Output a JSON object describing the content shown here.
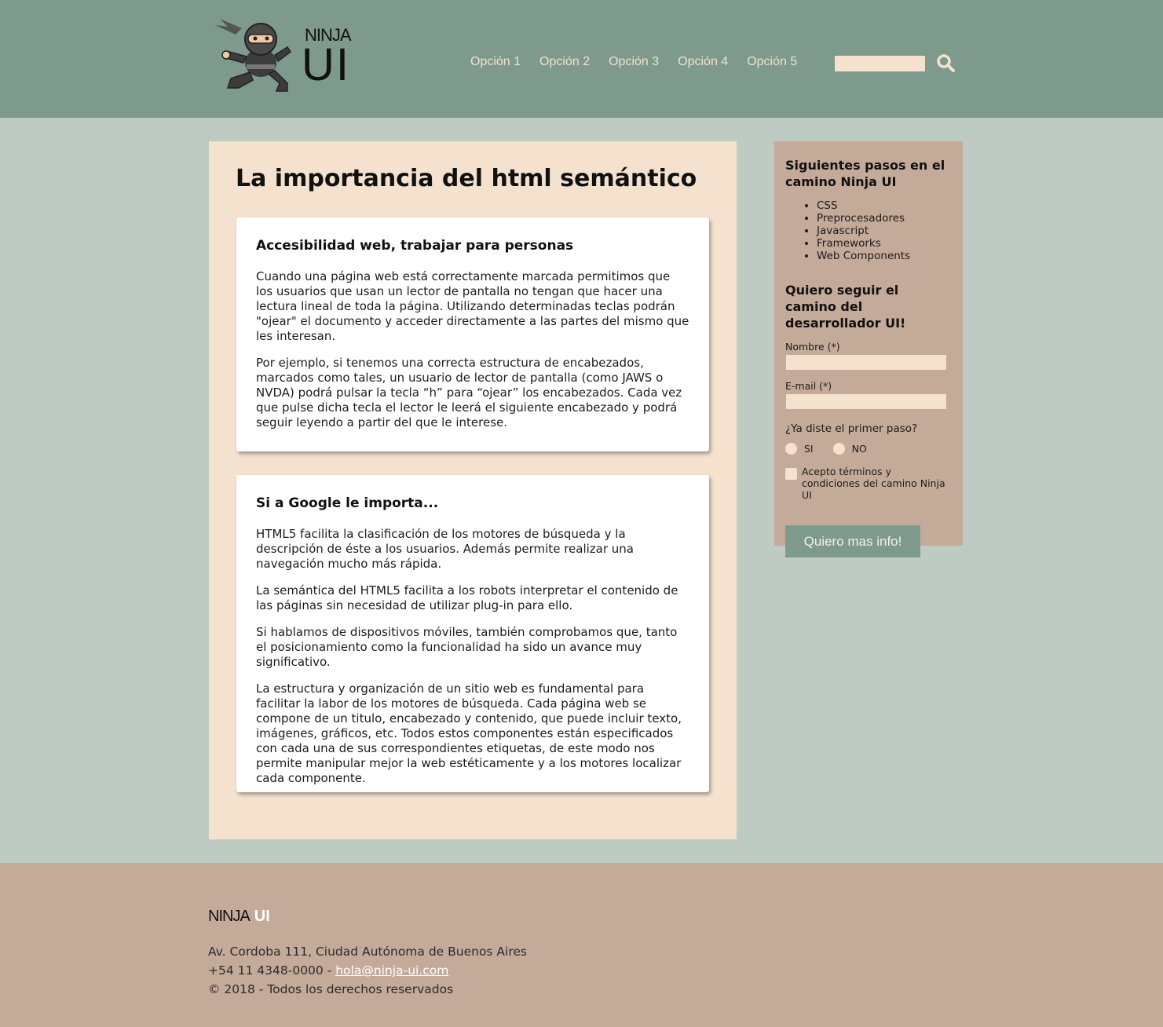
{
  "header": {
    "logo_top": "NINJA",
    "logo_bottom": "UI",
    "nav": [
      "Opción 1",
      "Opción 2",
      "Opción 3",
      "Opción 4",
      "Opción 5"
    ],
    "search_placeholder": ""
  },
  "article": {
    "title": "La importancia del html semántico",
    "sections": [
      {
        "heading": "Accesibilidad web, trabajar para personas",
        "paragraphs": [
          "Cuando una página web está correctamente marcada permitimos que los usuarios que usan un lector de pantalla no tengan que hacer una lectura lineal de toda la página. Utilizando determinadas teclas podrán \"ojear\" el documento y acceder directamente a las partes del mismo que les interesan.",
          "Por ejemplo, si tenemos una correcta estructura de encabezados, marcados como tales, un usuario de lector de pantalla (como JAWS o NVDA) podrá pulsar la tecla “h” para “ojear” los encabezados. Cada vez que pulse dicha tecla el lector le leerá el siguiente encabezado y podrá seguir leyendo a partir del que le interese."
        ]
      },
      {
        "heading": "Si a Google le importa...",
        "paragraphs": [
          "HTML5 facilita la clasificación de los motores de búsqueda y la descripción de éste a los usuarios. Además permite realizar una navegación mucho más rápida.",
          "La semántica del HTML5 facilita a los robots interpretar el contenido de las páginas sin necesidad de utilizar plug-in para ello.",
          "Si hablamos de dispositivos móviles, también comprobamos que, tanto el posicionamiento como la funcionalidad ha sido un avance muy significativo.",
          "La estructura y organización de un sitio web es fundamental para facilitar la labor de los motores de búsqueda. Cada página web se compone de un titulo, encabezado y contenido, que puede incluir texto, imágenes, gráficos, etc. Todos estos componentes están especificados con cada una de sus correspondientes etiquetas, de este modo nos permite manipular mejor la web estéticamente y a los motores localizar cada componente."
        ]
      }
    ]
  },
  "sidebar": {
    "next_steps_title": "Siguientes pasos en el camino Ninja UI",
    "next_steps": [
      "CSS",
      "Preprocesadores",
      "Javascript",
      "Frameworks",
      "Web Components"
    ],
    "form_title": "Quiero seguir el camino del desarrollador UI!",
    "name_label": "Nombre (*)",
    "email_label": "E-mail (*)",
    "question": "¿Ya diste el primer paso?",
    "radio_yes": "SI",
    "radio_no": "NO",
    "terms": "Acepto términos y condiciones del camino Ninja UI",
    "submit": "Quiero mas info!"
  },
  "footer": {
    "logo_left": "NINJA",
    "logo_right": "UI",
    "address": "Av. Cordoba 111, Ciudad Autónoma de Buenos Aires",
    "phone": "+54 11 4348-0000 - ",
    "email": "hola@ninja-ui.com",
    "copyright": "© 2018 - Todos los derechos reservados"
  },
  "colors": {
    "header_bg": "#7e9a8c",
    "page_bg": "#bdcbc3",
    "article_bg": "#f4e2cf",
    "sidebar_bg": "#c4aa99",
    "footer_bg": "#c4aa99"
  }
}
